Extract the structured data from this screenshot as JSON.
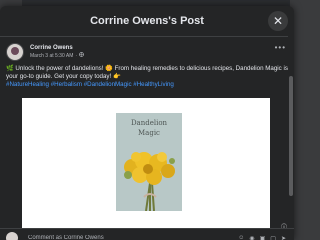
{
  "window": {
    "title": "Corrine Owens's Post",
    "close_symbol": "✕"
  },
  "post": {
    "author": "Corrine Owens",
    "timestamp": "March 3 at 5:30 AM",
    "privacy_icon": "globe-icon",
    "more_symbol": "•••",
    "body_text": "🌿 Unlock the power of dandelions! 🌼 From healing remedies to delicious recipes, Dandelion Magic is your go-to guide. Get your copy today! 👉",
    "hashtags": "#NatureHealing #Herbalism #DandelionMagic #HealthyLiving",
    "image": {
      "title": "Dandelion",
      "subtitle": "Magic",
      "background_color": "#ffffff"
    }
  },
  "comment_bar": {
    "placeholder": "Comment as Corrine Owens",
    "icons": [
      "emoji-icon",
      "camera-icon",
      "gif-icon",
      "sticker-icon",
      "send-icon"
    ]
  },
  "colors": {
    "modal_bg": "#242526",
    "text": "#e4e6eb",
    "secondary_text": "#b0b3b8",
    "hashtag": "#4599ff"
  }
}
